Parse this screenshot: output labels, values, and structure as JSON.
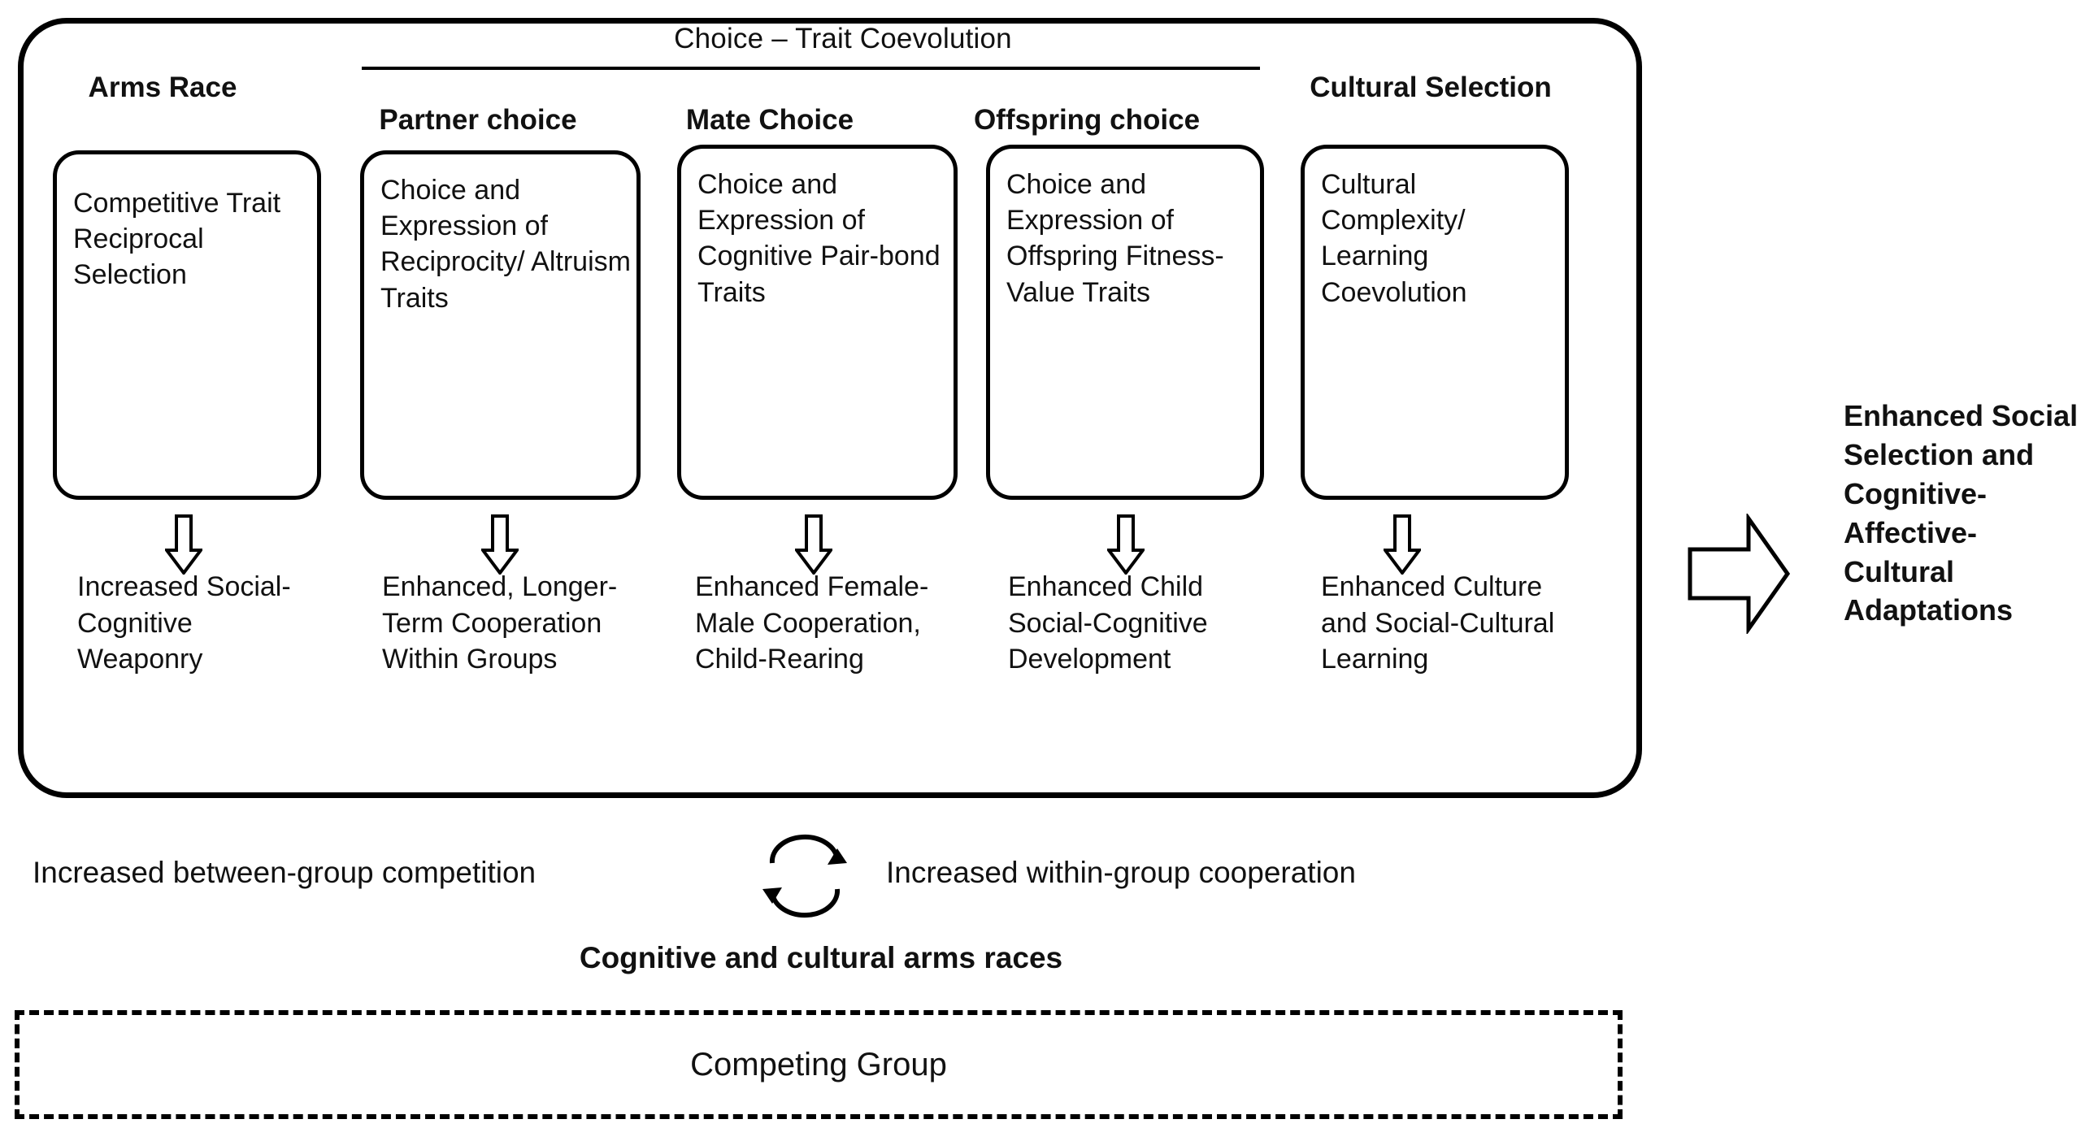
{
  "diagram": {
    "group_title": "Choice – Trait Coevolution",
    "columns": [
      {
        "header": "Arms Race",
        "trait": "Competitive Trait Reciprocal Selection",
        "outcome": "Increased Social-Cognitive Weaponry"
      },
      {
        "header": "Partner choice",
        "trait": "Choice and Expression of Reciprocity/ Altruism Traits",
        "outcome": "Enhanced, Longer-Term Cooperation Within Groups"
      },
      {
        "header": "Mate Choice",
        "trait": "Choice and Expression of Cognitive Pair-bond Traits",
        "outcome": "Enhanced Female-Male Cooperation, Child-Rearing"
      },
      {
        "header": "Offspring choice",
        "trait": "Choice and Expression of Offspring Fitness-Value Traits",
        "outcome": "Enhanced Child Social-Cognitive Development"
      },
      {
        "header": "Cultural Selection",
        "trait": "Cultural Complexity/ Learning Coevolution",
        "outcome": "Enhanced Culture and Social-Cultural Learning"
      }
    ],
    "result": "Enhanced Social Selection and Cognitive-Affective-Cultural Adaptations",
    "cycle_left": "Increased between-group competition",
    "cycle_right": "Increased within-group cooperation",
    "arms_races_label": "Cognitive and cultural arms races",
    "competing_group_label": "Competing Group"
  },
  "colors": {
    "stroke": "#000000",
    "background": "#ffffff"
  }
}
